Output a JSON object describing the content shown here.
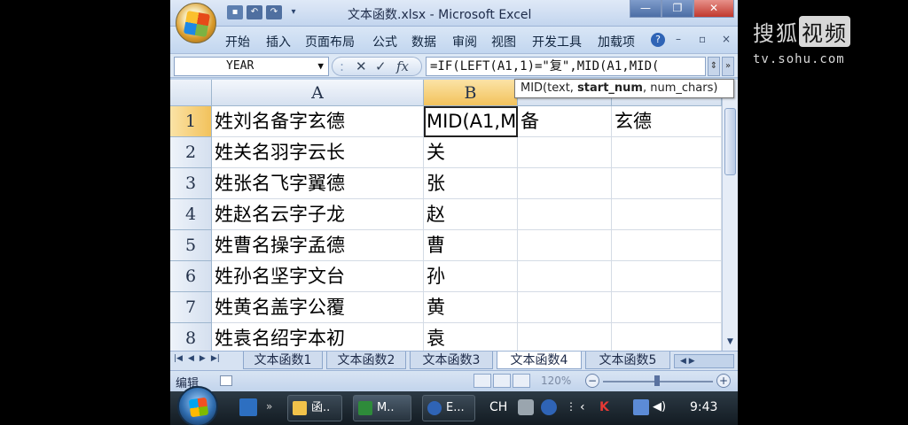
{
  "window": {
    "title": "文本函数.xlsx - Microsoft Excel",
    "controls": [
      "—",
      "❐",
      "✕"
    ]
  },
  "ribbon": {
    "tabs": [
      "开始",
      "插入",
      "页面布局",
      "公式",
      "数据",
      "审阅",
      "视图",
      "开发工具",
      "加载项"
    ],
    "help": "?",
    "mini_controls": [
      "–",
      "▫",
      "×"
    ]
  },
  "formula_bar": {
    "name_box": "YEAR",
    "formula": "=IF(LEFT(A1,1)=\"复\",MID(A1,MID(",
    "cancel_glyph": "✕",
    "enter_glyph": "✓",
    "fx_label": "fx"
  },
  "tooltip": {
    "prefix": "MID(text, ",
    "bold": "start_num",
    "suffix": ", num_chars)"
  },
  "grid": {
    "columns": [
      "A",
      "B",
      "",
      ""
    ],
    "rows": [
      {
        "num": "1",
        "a": "姓刘名备字玄德",
        "b": "MID(A1,M",
        "c": "备",
        "d": "玄德"
      },
      {
        "num": "2",
        "a": "姓关名羽字云长",
        "b": "关",
        "c": "",
        "d": ""
      },
      {
        "num": "3",
        "a": "姓张名飞字翼德",
        "b": "张",
        "c": "",
        "d": ""
      },
      {
        "num": "4",
        "a": "姓赵名云字子龙",
        "b": "赵",
        "c": "",
        "d": ""
      },
      {
        "num": "5",
        "a": "姓曹名操字孟德",
        "b": "曹",
        "c": "",
        "d": ""
      },
      {
        "num": "6",
        "a": "姓孙名坚字文台",
        "b": "孙",
        "c": "",
        "d": ""
      },
      {
        "num": "7",
        "a": "姓黄名盖字公覆",
        "b": "黄",
        "c": "",
        "d": ""
      },
      {
        "num": "8",
        "a": "姓袁名绍字本初",
        "b": "袁",
        "c": "",
        "d": ""
      }
    ]
  },
  "sheets": {
    "tabs": [
      "文本函数1",
      "文本函数2",
      "文本函数3",
      "文本函数4",
      "文本函数5"
    ],
    "active_index": 3
  },
  "status": {
    "mode": "编辑",
    "zoom": "120%"
  },
  "taskbar": {
    "items": [
      "函..",
      "M..",
      "E..."
    ],
    "tray_lang": "CH",
    "clock": "9:43"
  },
  "watermark": {
    "brand_a": "搜狐",
    "brand_b": "视频",
    "url": "tv.sohu.com"
  },
  "colors": {
    "accent": "#2f64b6",
    "active_header": "#f2c25c"
  }
}
